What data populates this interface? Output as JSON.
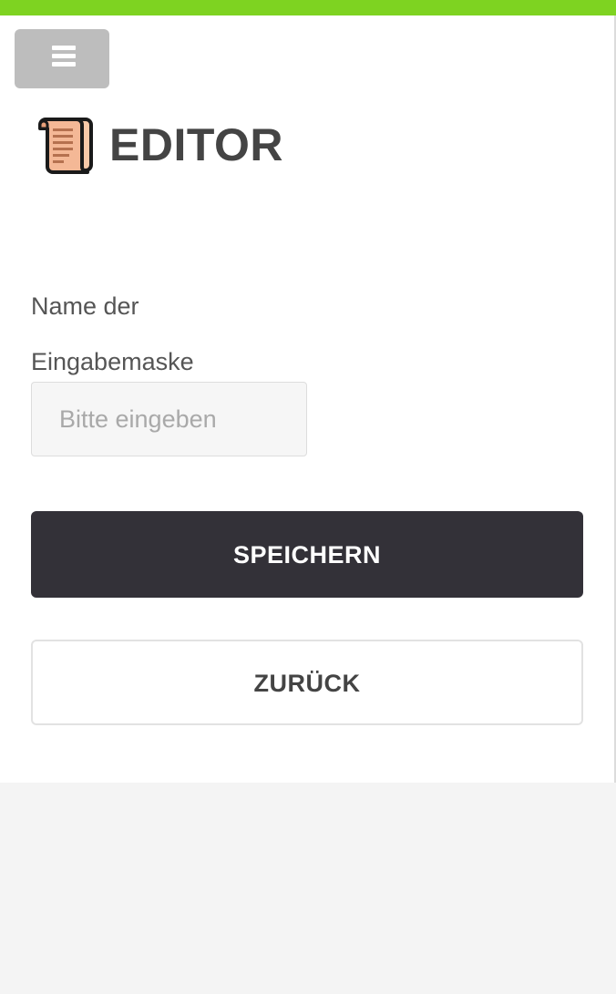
{
  "colors": {
    "accent": "#7ed321",
    "primary_button": "#333138",
    "menu_button": "#bdbdbd"
  },
  "header": {
    "icon": "scroll-icon",
    "title": "EDITOR"
  },
  "nav": {
    "menu_icon": "hamburger-menu-icon"
  },
  "form": {
    "name_label": "Name der Eingabemaske",
    "name_value": "",
    "name_placeholder": "Bitte eingeben"
  },
  "actions": {
    "save_label": "SPEICHERN",
    "back_label": "ZURÜCK"
  }
}
